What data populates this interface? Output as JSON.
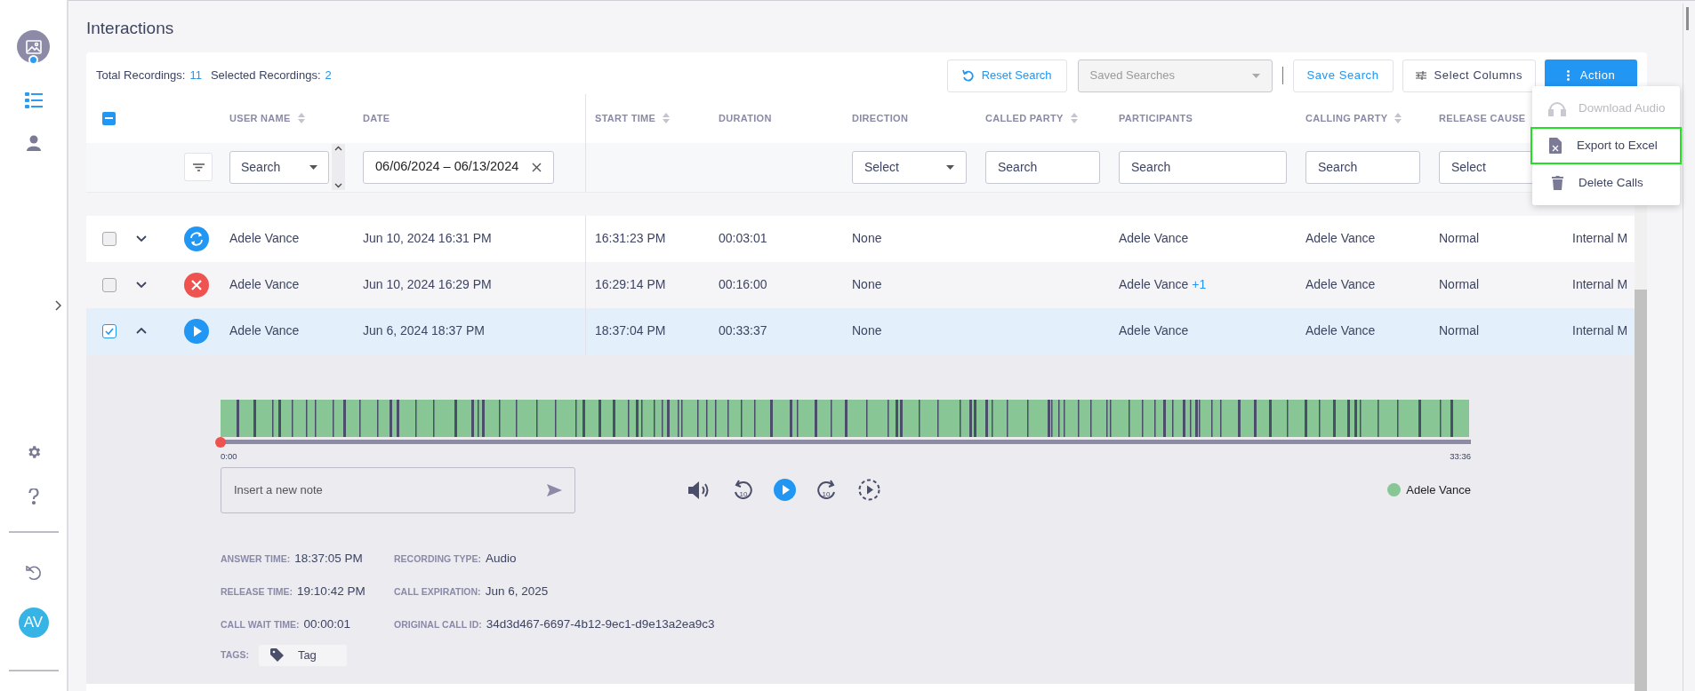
{
  "sidebar": {
    "nav": [
      {
        "kind": "list",
        "selected": true
      },
      {
        "kind": "person",
        "selected": false
      }
    ],
    "avatar": "AV"
  },
  "title": "Interactions",
  "summary": {
    "total_label": "Total Recordings:",
    "total": "11",
    "selected_label": "Selected Recordings:",
    "selected": "2"
  },
  "toolbar": {
    "reset": "Reset Search",
    "saved_searches": "Saved Searches",
    "save": "Save Search",
    "select_columns": "Select Columns",
    "action": "Action"
  },
  "action_menu": [
    {
      "kind": "headphones",
      "label": "Download Audio",
      "disabled": true,
      "highlighted": false
    },
    {
      "kind": "excel",
      "label": "Export to Excel",
      "disabled": false,
      "highlighted": true
    },
    {
      "kind": "trash",
      "label": "Delete Calls",
      "disabled": false,
      "highlighted": false
    }
  ],
  "select_all": {
    "indeterminate": true
  },
  "columns": [
    {
      "label": "USER NAME",
      "sortable": true,
      "filter": {
        "kind": "dropdown",
        "value": "Search"
      }
    },
    {
      "label": "DATE",
      "sortable": false,
      "filter": {
        "kind": "date",
        "value": "06/06/2024 – 06/13/2024"
      }
    },
    {
      "label": "START TIME",
      "sortable": true
    },
    {
      "label": "DURATION",
      "sortable": false
    },
    {
      "label": "DIRECTION",
      "sortable": false,
      "filter": {
        "kind": "select",
        "placeholder": "Select"
      }
    },
    {
      "label": "CALLED PARTY",
      "sortable": true,
      "filter": {
        "kind": "search",
        "placeholder": "Search"
      }
    },
    {
      "label": "PARTICIPANTS",
      "sortable": false,
      "filter": {
        "kind": "search",
        "placeholder": "Search"
      }
    },
    {
      "label": "CALLING PARTY",
      "sortable": true,
      "filter": {
        "kind": "search",
        "placeholder": "Search"
      }
    },
    {
      "label": "RELEASE CAUSE",
      "sortable": false,
      "filter": {
        "kind": "select",
        "placeholder": "Select"
      }
    }
  ],
  "rows": [
    {
      "checked": false,
      "expanded": false,
      "selected": false,
      "kind": "sync",
      "cells": [
        "Adele Vance",
        "Jun 10, 2024 16:31 PM",
        "16:31:23 PM",
        "00:03:01",
        "None",
        "",
        "Adele Vance",
        "Adele Vance",
        "Normal",
        "Internal M"
      ],
      "participants_extra": ""
    },
    {
      "checked": false,
      "expanded": false,
      "selected": false,
      "kind": "failed",
      "cells": [
        "Adele Vance",
        "Jun 10, 2024 16:29 PM",
        "16:29:14 PM",
        "00:16:00",
        "None",
        "",
        "Adele Vance",
        "Adele Vance",
        "Normal",
        "Internal M"
      ],
      "participants_extra": "+1"
    },
    {
      "checked": true,
      "expanded": true,
      "selected": true,
      "kind": "play",
      "cells": [
        "Adele Vance",
        "Jun 6, 2024 18:37 PM",
        "18:37:04 PM",
        "00:33:37",
        "None",
        "",
        "Adele Vance",
        "Adele Vance",
        "Normal",
        "Internal M"
      ],
      "participants_extra": ""
    }
  ],
  "player": {
    "level": 0,
    "skip_back": "10",
    "skip_forward": "10",
    "start": "0:00",
    "end": "33:36",
    "note_placeholder": "Insert a new note",
    "legend": [
      {
        "name": "Adele Vance",
        "color": "#88c695"
      }
    ]
  },
  "details": [
    {
      "label": "ANSWER TIME:",
      "value": "18:37:05 PM"
    },
    {
      "label": "RECORDING TYPE:",
      "value": "Audio"
    },
    {
      "label": "RELEASE TIME:",
      "value": "19:10:42 PM"
    },
    {
      "label": "CALL EXPIRATION:",
      "value": "Jun 6, 2025"
    },
    {
      "label": "CALL WAIT TIME:",
      "value": "00:00:01"
    },
    {
      "label": "ORIGINAL CALL ID:",
      "value": "34d3d467-6697-4b12-9ec1-d9e13a2ea9c3"
    }
  ],
  "tags": {
    "label": "TAGS:",
    "items": [
      "Tag"
    ]
  }
}
